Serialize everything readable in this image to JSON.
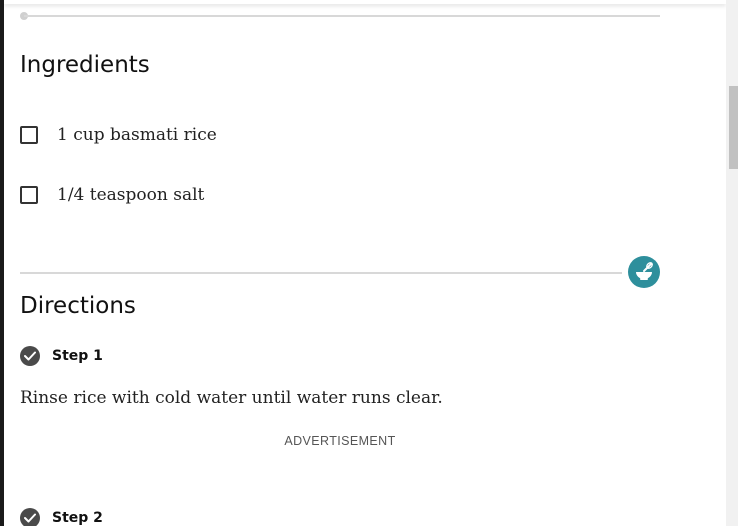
{
  "ingredients": {
    "heading": "Ingredients",
    "items": [
      {
        "label": "1 cup basmati rice",
        "checked": false
      },
      {
        "label": "1/4 teaspoon salt",
        "checked": false
      }
    ]
  },
  "directions": {
    "heading": "Directions",
    "steps": [
      {
        "label": "Step 1",
        "text": "Rinse rice with cold water until water runs clear."
      },
      {
        "label": "Step 2"
      }
    ]
  },
  "advertisement": {
    "label": "ADVERTISEMENT"
  },
  "icons": {
    "mix_icon": "mixing-bowl-whisk-icon",
    "step_check": "checkmark-circle-icon"
  },
  "colors": {
    "accent": "#2e8f9c",
    "step_check": "#4a4a4a",
    "divider": "#d8d8d8"
  }
}
